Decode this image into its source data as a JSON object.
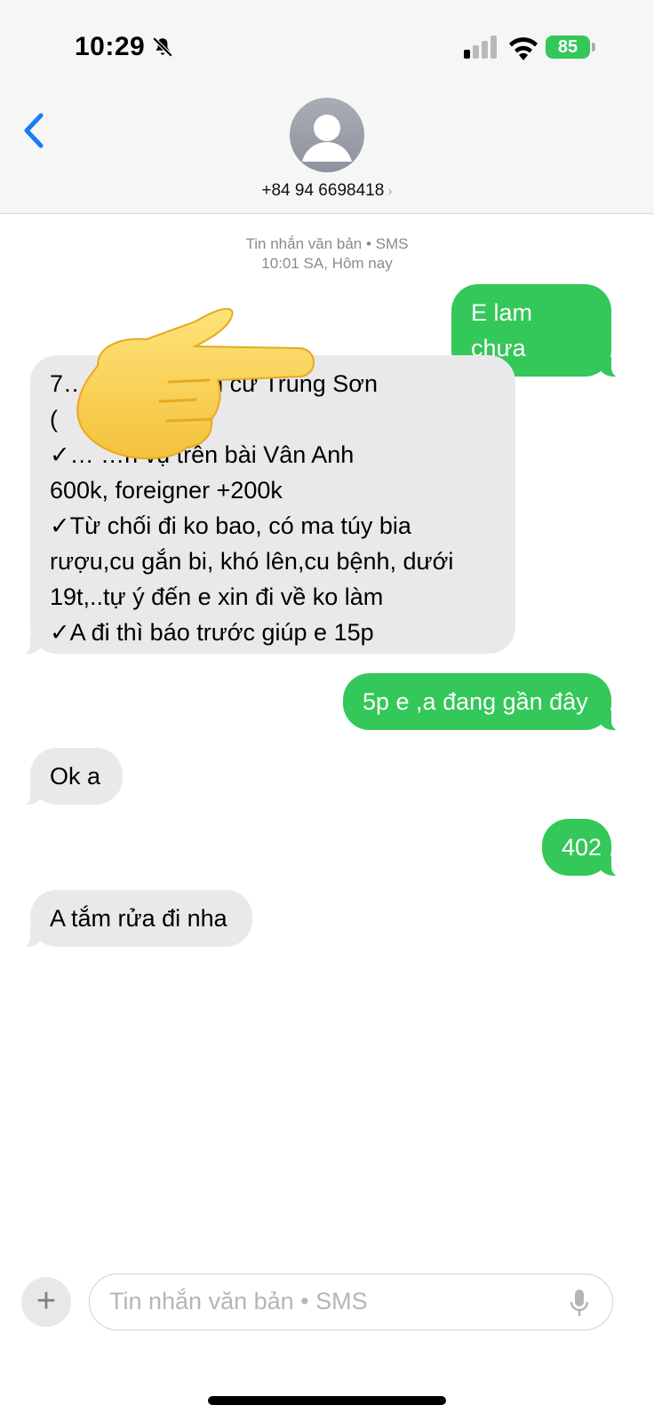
{
  "status_bar": {
    "time": "10:29",
    "battery": "85"
  },
  "header": {
    "contact": "+84 94 6698418"
  },
  "meta": {
    "service": "Tin nhắn văn bản • SMS",
    "timestamp": "10:01 SA, Hôm nay"
  },
  "messages": [
    {
      "direction": "out",
      "text": "E lam chưa"
    },
    {
      "direction": "in",
      "lines": [
        "7… …9,khu dân cư Trung Sơn",
        "(",
        "✓… …h vụ trên bài Vân Anh",
        "600k, foreigner +200k",
        "✓Từ chối đi ko bao, có ma túy bia",
        "rượu,cu gắn bi, khó lên,cu bệnh, dưới",
        "19t,..tự ý đến e xin đi về ko làm",
        "✓A đi thì báo trước giúp e 15p"
      ]
    },
    {
      "direction": "out",
      "text": "5p e ,a đang gần đây"
    },
    {
      "direction": "in",
      "text": "Ok a"
    },
    {
      "direction": "out",
      "text": "402"
    },
    {
      "direction": "in",
      "text": "A tắm rửa đi nha"
    }
  ],
  "composer": {
    "placeholder": "Tin nhắn văn bản • SMS"
  },
  "colors": {
    "sent": "#34c759",
    "received": "#e9e9eb",
    "accent": "#1a7cf0"
  },
  "icons": [
    "bell-slash-icon",
    "signal-icon",
    "wifi-icon",
    "battery-icon",
    "back-chevron-icon",
    "contact-avatar-icon",
    "plus-icon",
    "microphone-icon",
    "pointing-hand-emoji"
  ]
}
